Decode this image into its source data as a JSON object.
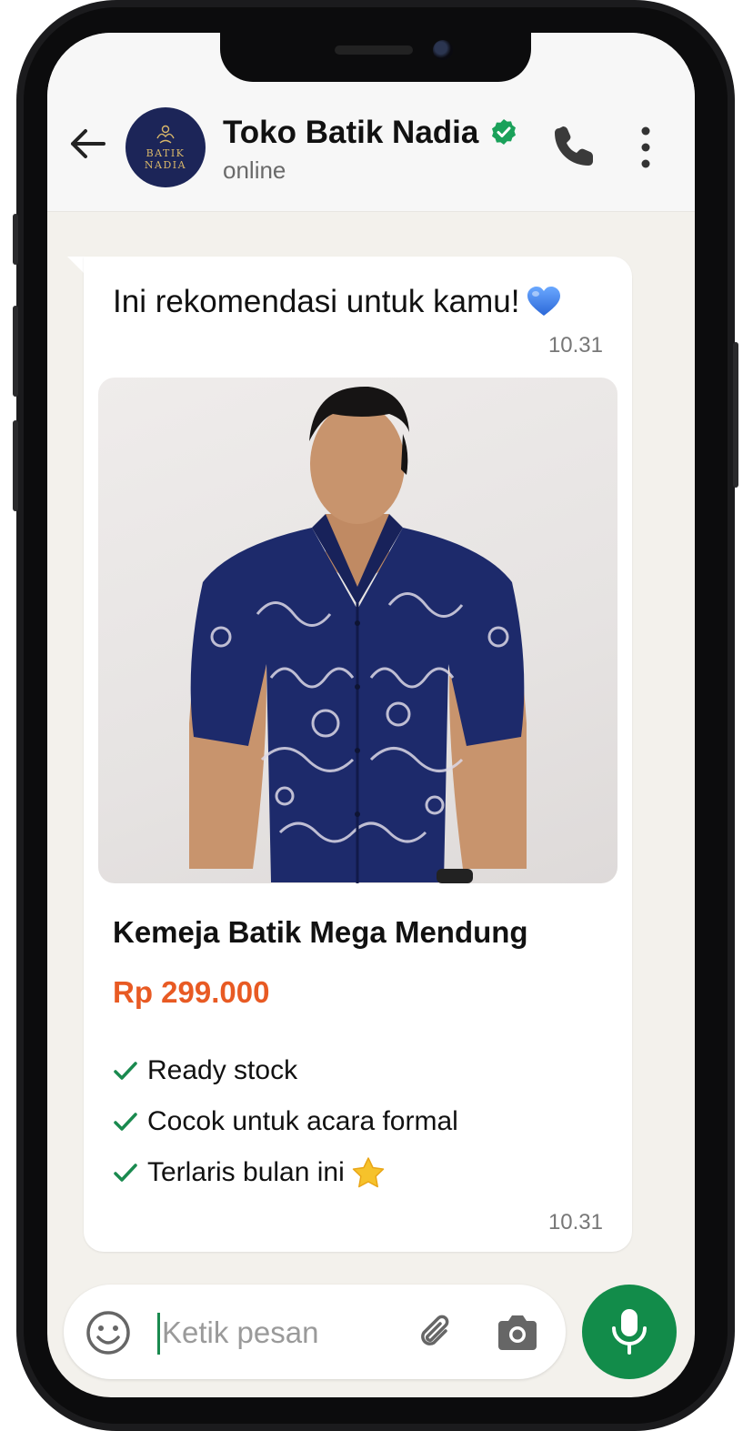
{
  "header": {
    "title": "Toko Batik Nadia",
    "status": "online",
    "avatar_brand_line1": "BATIK",
    "avatar_brand_line2": "NADIA"
  },
  "messages": [
    {
      "text": "Ini rekomendasi untuk kamu!",
      "emoji": "blue-heart",
      "time": "10.31"
    },
    {
      "type": "product",
      "image_alt": "man wearing navy batik shirt",
      "title": "Kemeja Batik Mega Mendung",
      "price": "Rp 299.000",
      "features": [
        "Ready stock",
        "Cocok untuk acara formal",
        "Terlaris bulan ini"
      ],
      "feature_emoji": "star",
      "time": "10.31"
    }
  ],
  "input": {
    "placeholder": "Ketik pesan",
    "value": ""
  },
  "colors": {
    "accent_green": "#128c4a",
    "price_orange": "#e85a23",
    "verified_green": "#1aa15a",
    "avatar_navy": "#1c2558",
    "shirt_navy": "#1d2a6b"
  },
  "icons": [
    "back-arrow-icon",
    "verified-badge-icon",
    "phone-call-icon",
    "more-options-icon",
    "check-icon",
    "emoji-icon",
    "attach-icon",
    "camera-icon",
    "mic-icon"
  ]
}
